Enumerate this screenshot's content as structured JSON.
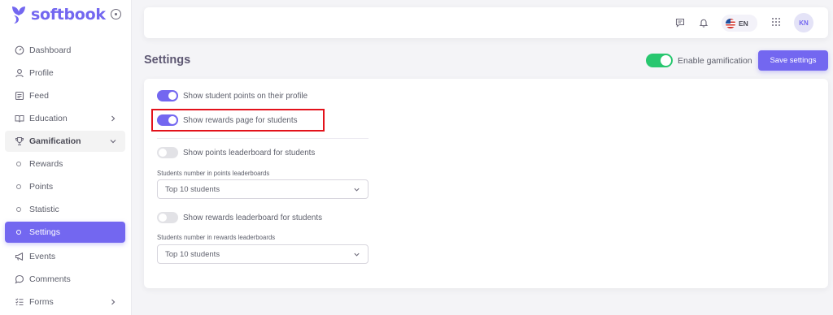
{
  "app": {
    "brand": "softbook"
  },
  "sidebar": {
    "items": [
      {
        "label": "Dashboard",
        "icon": "dashboard-icon"
      },
      {
        "label": "Profile",
        "icon": "user-icon"
      },
      {
        "label": "Feed",
        "icon": "feed-icon"
      },
      {
        "label": "Education",
        "icon": "book-icon"
      },
      {
        "label": "Gamification",
        "icon": "trophy-icon"
      },
      {
        "label": "Rewards"
      },
      {
        "label": "Points"
      },
      {
        "label": "Statistic"
      },
      {
        "label": "Settings"
      },
      {
        "label": "Events",
        "icon": "megaphone-icon"
      },
      {
        "label": "Comments",
        "icon": "comment-icon"
      },
      {
        "label": "Forms",
        "icon": "list-icon"
      }
    ]
  },
  "header": {
    "language": "EN",
    "avatar_initials": "KN"
  },
  "page": {
    "title": "Settings",
    "enable_gamification_label": "Enable gamification",
    "save_label": "Save settings"
  },
  "settings": {
    "student_points": {
      "label": "Show student points on their profile",
      "enabled": true
    },
    "rewards_page": {
      "label": "Show rewards page for students",
      "enabled": true
    },
    "points_leaderboard": {
      "label": "Show points leaderboard for students",
      "enabled": false
    },
    "points_leaderboard_count": {
      "label": "Students number in points leaderboards",
      "value": "Top 10 students"
    },
    "rewards_leaderboard": {
      "label": "Show rewards leaderboard for students",
      "enabled": false
    },
    "rewards_leaderboard_count": {
      "label": "Students number in rewards leaderboards",
      "value": "Top 10 students"
    }
  },
  "colors": {
    "accent": "#7367f0",
    "success": "#28c76f",
    "highlight": "#e3121b"
  }
}
